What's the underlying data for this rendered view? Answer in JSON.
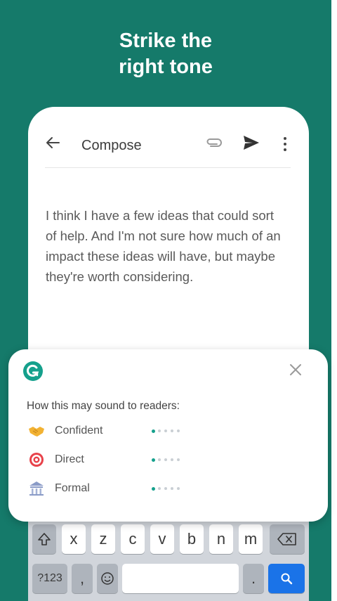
{
  "headline": {
    "line1": "Strike the",
    "line2": "right tone"
  },
  "compose": {
    "title": "Compose",
    "body": "I think I have a few ideas that could sort of help. And I'm not sure how much of an impact these ideas will have, but maybe they're worth considering."
  },
  "card": {
    "heading": "How this may sound to readers:",
    "tones": [
      {
        "label": "Confident",
        "icon": "handshake-icon",
        "level": 1,
        "max": 5
      },
      {
        "label": "Direct",
        "icon": "target-icon",
        "level": 1,
        "max": 5
      },
      {
        "label": "Formal",
        "icon": "building-icon",
        "level": 1,
        "max": 5
      }
    ]
  },
  "keyboard": {
    "row3": [
      "x",
      "z",
      "c",
      "v",
      "b",
      "n",
      "m"
    ],
    "numbers_key": "?123",
    "comma_key": ",",
    "period_key": "."
  },
  "colors": {
    "brand": "#157a6a",
    "accent": "#15a08c",
    "search_key": "#1a73e8"
  }
}
